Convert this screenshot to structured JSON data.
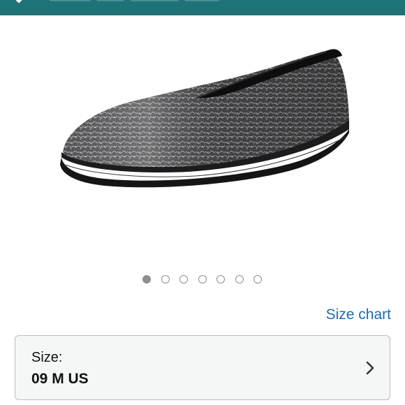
{
  "header": {
    "icon": "chevron-down-icon",
    "background_color": "#1f7278"
  },
  "product": {
    "image_icon": "shoe-image",
    "image_alt": "Metallic black slip-on loafer shoe"
  },
  "carousel": {
    "total": 7,
    "active_index": 0
  },
  "size_chart": {
    "label": "Size chart",
    "color": "#1d6bb0"
  },
  "size_selector": {
    "label": "Size:",
    "value": "09 M US",
    "icon": "chevron-right-icon"
  }
}
